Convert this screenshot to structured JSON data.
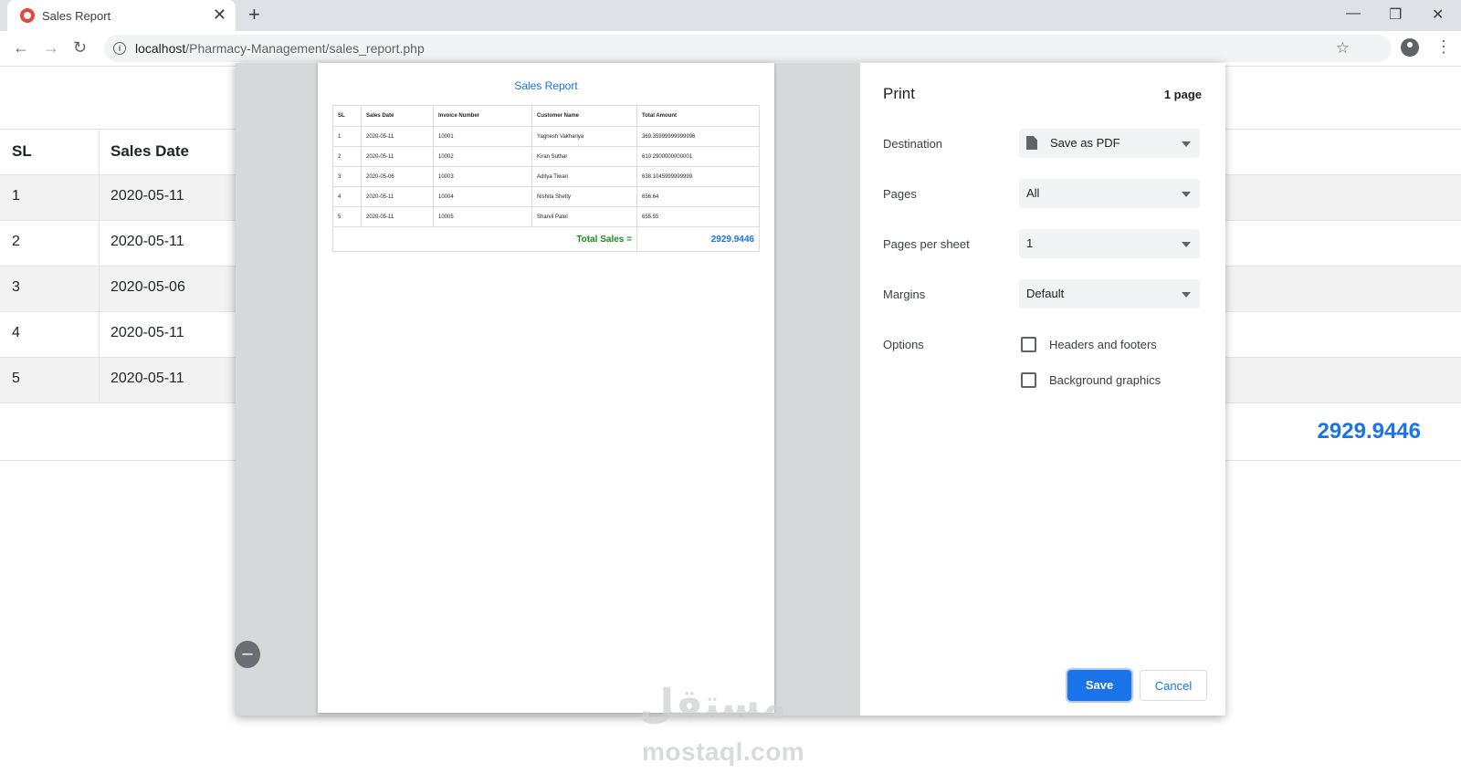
{
  "browser": {
    "tab_title": "Sales Report",
    "tab_close": "✕",
    "new_tab": "+",
    "url_host": "localhost",
    "url_path": "/Pharmacy-Management/sales_report.php",
    "minimize": "—",
    "restore": "❐",
    "close": "✕"
  },
  "background_table": {
    "headers": [
      "SL",
      "Sales Date"
    ],
    "rows": [
      {
        "sl": "1",
        "date": "2020-05-11"
      },
      {
        "sl": "2",
        "date": "2020-05-11"
      },
      {
        "sl": "3",
        "date": "2020-05-06"
      },
      {
        "sl": "4",
        "date": "2020-05-11"
      },
      {
        "sl": "5",
        "date": "2020-05-11"
      }
    ],
    "total": "2929.9446"
  },
  "preview": {
    "title": "Sales Report",
    "headers": [
      "SL",
      "Sales Date",
      "Invoice Number",
      "Customer Name",
      "Total Amount"
    ],
    "rows": [
      [
        "1",
        "2020-05-11",
        "10001",
        "Yagnesh Vakhariya",
        "369.35999999999996"
      ],
      [
        "2",
        "2020-05-11",
        "10002",
        "Kiran Suthar",
        "610.2900000000001"
      ],
      [
        "3",
        "2020-05-06",
        "10003",
        "Aditya Tiwari",
        "638.1045999999999"
      ],
      [
        "4",
        "2020-05-11",
        "10004",
        "Nishita Shetty",
        "656.64"
      ],
      [
        "5",
        "2020-05-11",
        "10005",
        "Sharvil Patel",
        "655.55"
      ]
    ],
    "total_label": "Total Sales =",
    "total_value": "2929.9446",
    "zoom_out": "–"
  },
  "print": {
    "title": "Print",
    "page_count": "1 page",
    "destination_label": "Destination",
    "destination_value": "Save as PDF",
    "pages_label": "Pages",
    "pages_value": "All",
    "pps_label": "Pages per sheet",
    "pps_value": "1",
    "margins_label": "Margins",
    "margins_value": "Default",
    "options_label": "Options",
    "opt_headers": "Headers and footers",
    "opt_background": "Background graphics",
    "save": "Save",
    "cancel": "Cancel"
  },
  "watermark": {
    "arabic": "مستقل",
    "latin": "mostaql.com"
  }
}
